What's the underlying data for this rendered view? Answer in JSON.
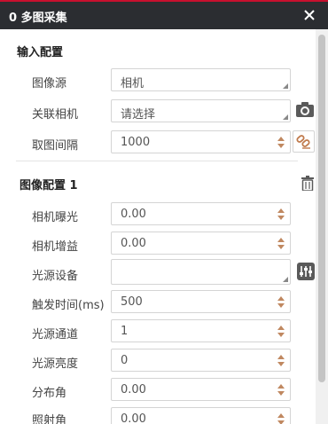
{
  "window": {
    "title": "0 多图采集"
  },
  "input_config": {
    "title": "输入配置",
    "rows": [
      {
        "label": "图像源",
        "value": "相机"
      },
      {
        "label": "关联相机",
        "value": "请选择"
      },
      {
        "label": "取图间隔",
        "value": "1000"
      }
    ]
  },
  "image_config": {
    "title": "图像配置 1",
    "rows": [
      {
        "label": "相机曝光",
        "value": "0.00"
      },
      {
        "label": "相机增益",
        "value": "0.00"
      },
      {
        "label": "光源设备",
        "value": ""
      },
      {
        "label": "触发时间(ms)",
        "value": "500"
      },
      {
        "label": "光源通道",
        "value": "1"
      },
      {
        "label": "光源亮度",
        "value": "0"
      },
      {
        "label": "分布角",
        "value": "0.00"
      },
      {
        "label": "照射角",
        "value": "0.00"
      }
    ]
  },
  "icons": {
    "close": "close-icon",
    "camera": "camera-icon",
    "link": "link-icon",
    "delete": "trash-icon",
    "settings": "sliders-icon"
  },
  "colors": {
    "accent": "#c8102e",
    "titlebar": "#2b2d31"
  }
}
